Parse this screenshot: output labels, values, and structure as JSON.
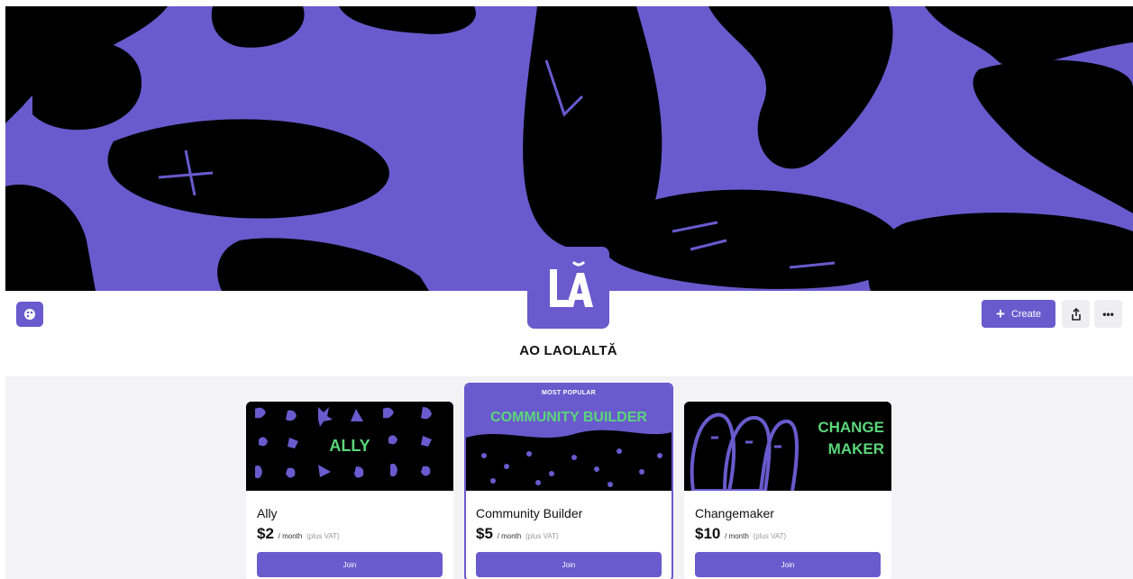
{
  "colors": {
    "accent": "#6a5acd",
    "banner_dark": "#000000",
    "tier_text_green": "#5ad67a"
  },
  "creator": {
    "name": "AO LAOLALTĂ",
    "avatar_monogram": "LĂ"
  },
  "header": {
    "create_label": "Create",
    "create_icon": "plus-icon",
    "share_icon": "share-icon",
    "more_icon": "more-icon",
    "theme_icon": "palette-icon"
  },
  "tiers": [
    {
      "name": "Ally",
      "image_text": "ALLY",
      "price": "$2",
      "per": "/ month",
      "vat": "(plus VAT)",
      "join_label": "Join"
    },
    {
      "name": "Community Builder",
      "badge": "MOST POPULAR",
      "image_text": "COMMUNITY BUILDER",
      "price": "$5",
      "per": "/ month",
      "vat": "(plus VAT)",
      "join_label": "Join"
    },
    {
      "name": "Changemaker",
      "image_text_line1": "CHANGE",
      "image_text_line2": "MAKER",
      "price": "$10",
      "per": "/ month",
      "vat": "(plus VAT)",
      "join_label": "Join"
    }
  ]
}
